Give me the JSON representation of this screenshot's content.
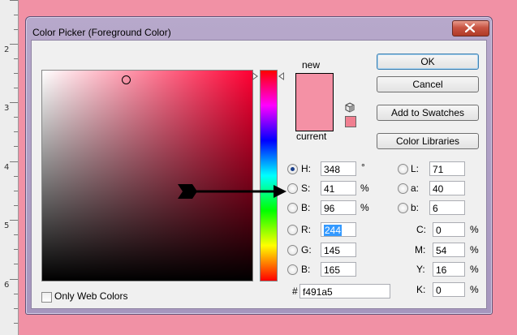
{
  "ruler": {
    "numbers": [
      "2",
      "3",
      "4",
      "5",
      "6"
    ]
  },
  "dialog": {
    "title": "Color Picker (Foreground Color)",
    "new_label": "new",
    "current_label": "current",
    "new_color": "#f491a5",
    "current_color": "#f491a5",
    "buttons": {
      "ok": "OK",
      "cancel": "Cancel",
      "add_swatches": "Add to Swatches",
      "libraries": "Color Libraries"
    },
    "hsb": {
      "h": {
        "label": "H:",
        "value": "348",
        "unit": "°"
      },
      "s": {
        "label": "S:",
        "value": "41",
        "unit": "%"
      },
      "b": {
        "label": "B:",
        "value": "96",
        "unit": "%"
      }
    },
    "rgb": {
      "r": {
        "label": "R:",
        "value": "244"
      },
      "g": {
        "label": "G:",
        "value": "145"
      },
      "b": {
        "label": "B:",
        "value": "165"
      }
    },
    "lab": {
      "l": {
        "label": "L:",
        "value": "71"
      },
      "a": {
        "label": "a:",
        "value": "40"
      },
      "b": {
        "label": "b:",
        "value": "6"
      }
    },
    "cmyk": {
      "c": {
        "label": "C:",
        "value": "0",
        "unit": "%"
      },
      "m": {
        "label": "M:",
        "value": "54",
        "unit": "%"
      },
      "y": {
        "label": "Y:",
        "value": "16",
        "unit": "%"
      },
      "k": {
        "label": "K:",
        "value": "0",
        "unit": "%"
      }
    },
    "hex": {
      "label": "#",
      "value": "f491a5"
    },
    "only_web_colors": "Only Web Colors",
    "selected_mode": "H"
  },
  "colors": {
    "background": "#f191a5",
    "accent": "#3399ff"
  }
}
